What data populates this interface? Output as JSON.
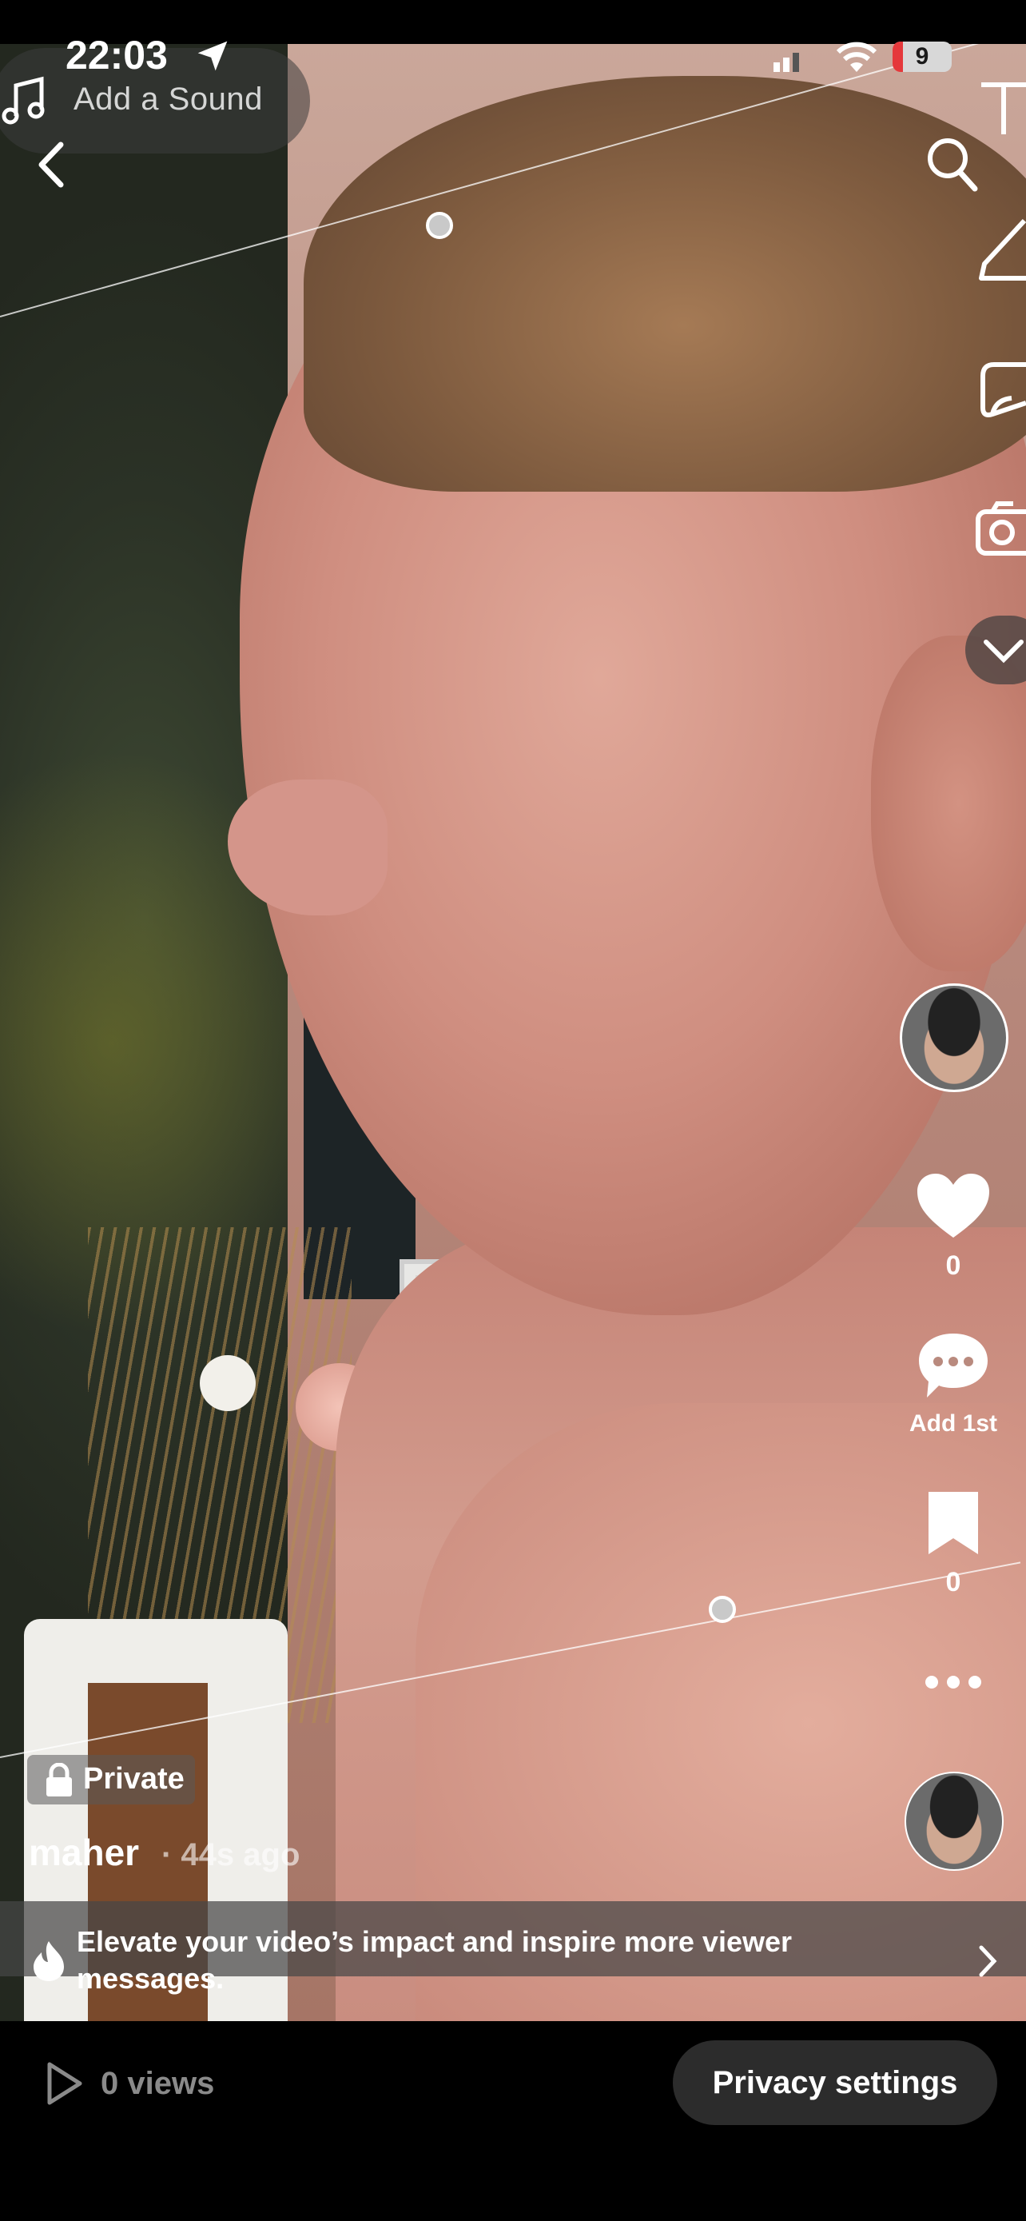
{
  "status_bar": {
    "time": "22:03",
    "battery_level": "9",
    "battery_color": "#e5383b",
    "icons": [
      "location-arrow-icon",
      "signal-icon",
      "wifi-icon",
      "battery-icon"
    ]
  },
  "top": {
    "sound_label": "Add a Sound",
    "icons": [
      "music-note-icon",
      "back-chevron-icon"
    ]
  },
  "side_tools": {
    "icons": [
      "text-tool-icon",
      "search-icon",
      "pencil-icon",
      "sticker-icon",
      "camera-icon",
      "collapse-chevron-icon"
    ]
  },
  "rail": {
    "like_count": "0",
    "comment_label": "Add 1st",
    "save_count": "0",
    "icons": [
      "avatar",
      "heart-icon",
      "comment-icon",
      "bookmark-icon",
      "more-icon",
      "sound-disc-avatar"
    ]
  },
  "post": {
    "privacy_badge": "Private",
    "username": "maher",
    "time_ago": "· 44s ago"
  },
  "promo": {
    "text": "Elevate your video’s impact and inspire more viewer messages.",
    "icons": [
      "flame-icon",
      "chevron-right-icon"
    ]
  },
  "footer": {
    "views_label": "0 views",
    "privacy_button": "Privacy settings",
    "icons": [
      "play-outline-icon"
    ]
  }
}
